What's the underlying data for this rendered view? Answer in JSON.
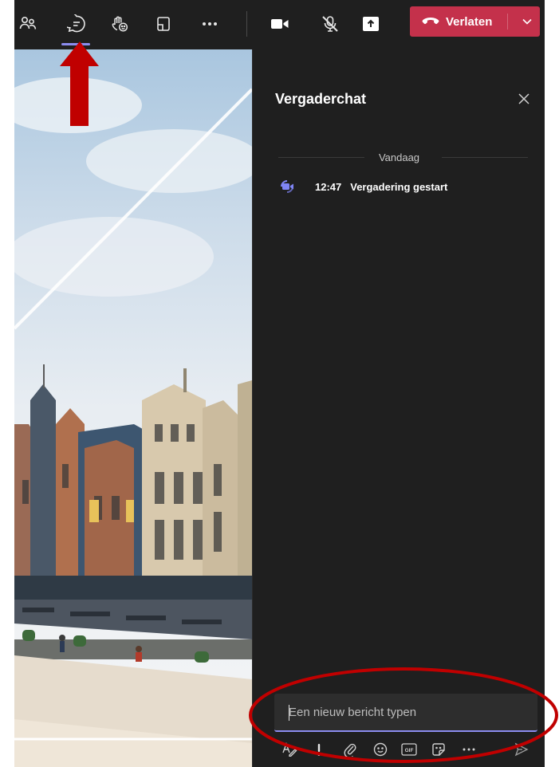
{
  "toolbar": {
    "items": [
      {
        "name": "people-icon"
      },
      {
        "name": "chat-icon"
      },
      {
        "name": "raise-hand-icon"
      },
      {
        "name": "rooms-icon"
      },
      {
        "name": "more-icon"
      },
      {
        "name": "camera-icon"
      },
      {
        "name": "mic-off-icon"
      },
      {
        "name": "share-icon"
      }
    ],
    "leave_label": "Verlaten",
    "leave_color": "#c4314b",
    "active_indicator_color": "#8b8cf0"
  },
  "chat": {
    "title": "Vergaderchat",
    "day_separator": "Vandaag",
    "events": [
      {
        "time": "12:47",
        "text": "Vergadering gestart",
        "icon": "meeting-video-icon"
      }
    ],
    "compose": {
      "placeholder": "Een nieuw bericht typen",
      "tools": [
        "format-icon",
        "important-icon",
        "attach-icon",
        "emoji-icon",
        "gif-icon",
        "sticker-icon",
        "more-options-icon",
        "send-icon"
      ]
    }
  },
  "annotations": {
    "arrow_color": "#c00000",
    "highlight_color": "#c00000"
  }
}
